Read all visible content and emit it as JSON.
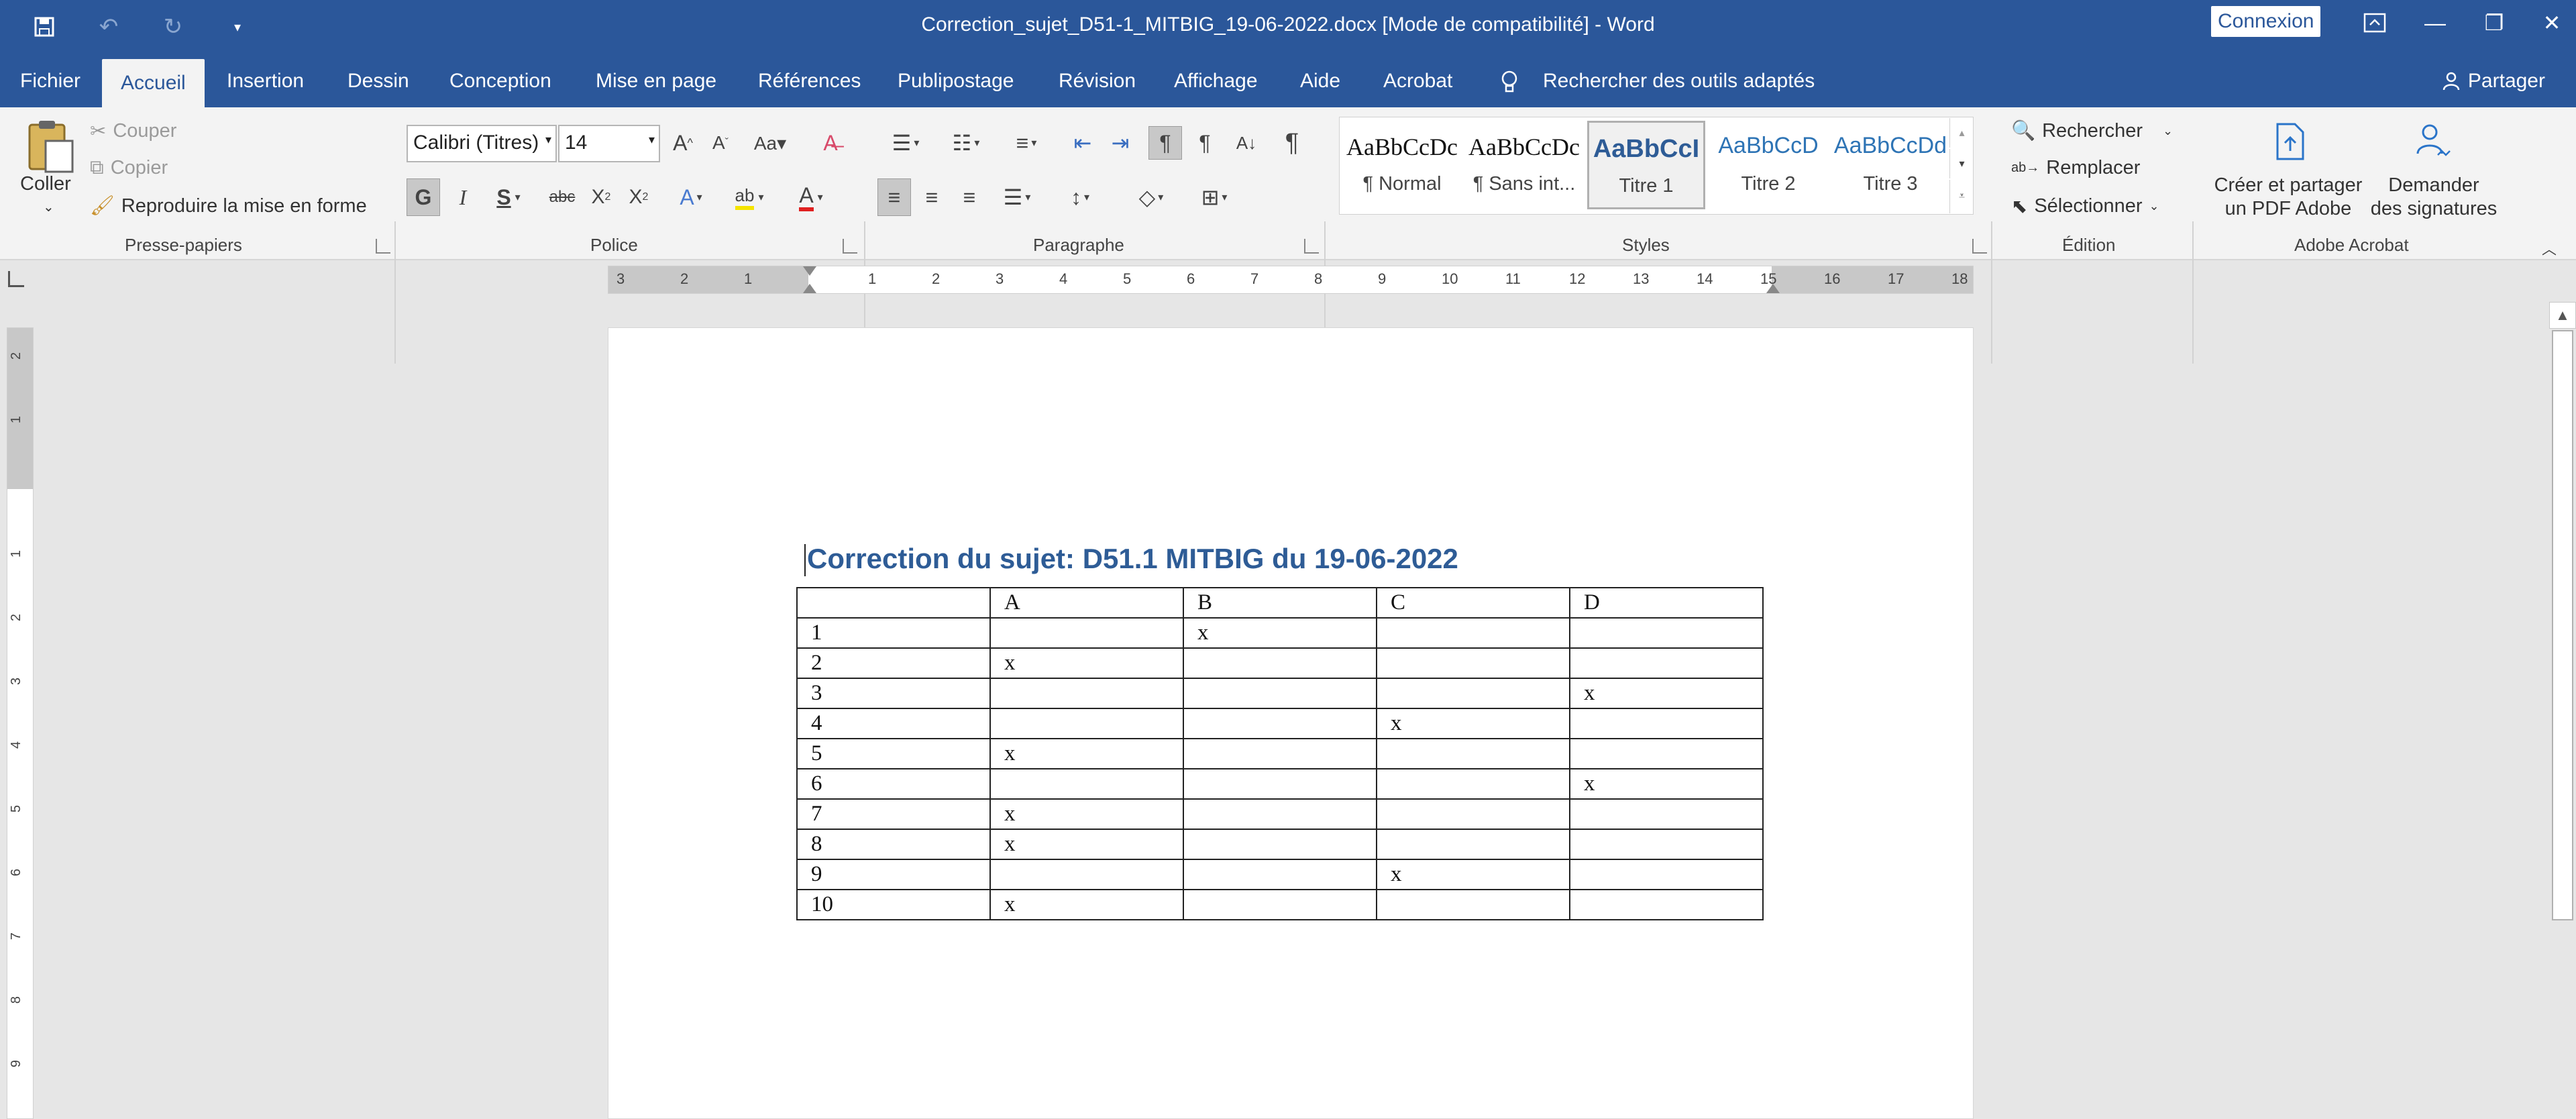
{
  "titlebar": {
    "document_title": "Correction_sujet_D51-1_MITBIG_19-06-2022.docx [Mode de compatibilité]  -  Word",
    "signin_label": "Connexion"
  },
  "tabs": [
    "Fichier",
    "Accueil",
    "Insertion",
    "Dessin",
    "Conception",
    "Mise en page",
    "Références",
    "Publipostage",
    "Révision",
    "Affichage",
    "Aide",
    "Acrobat"
  ],
  "tell_me": "Rechercher des outils adaptés",
  "share_label": "Partager",
  "clipboard": {
    "paste": "Coller",
    "cut": "Couper",
    "copy": "Copier",
    "format_painter": "Reproduire la mise en forme",
    "group": "Presse-papiers"
  },
  "font": {
    "name": "Calibri (Titres)",
    "size": "14",
    "group": "Police"
  },
  "paragraph": {
    "group": "Paragraphe"
  },
  "styles": {
    "group": "Styles",
    "items": [
      {
        "preview": "AaBbCcDc",
        "name": "¶ Normal",
        "color": "#111111"
      },
      {
        "preview": "AaBbCcDc",
        "name": "¶ Sans int...",
        "color": "#111111"
      },
      {
        "preview": "AaBbCcI",
        "name": "Titre 1",
        "color": "#2e5c96"
      },
      {
        "preview": "AaBbCcD",
        "name": "Titre 2",
        "color": "#2e74b5"
      },
      {
        "preview": "AaBbCcDd",
        "name": "Titre 3",
        "color": "#2e74b5"
      }
    ]
  },
  "editing": {
    "find": "Rechercher",
    "replace": "Remplacer",
    "select": "Sélectionner",
    "group": "Édition"
  },
  "acrobat": {
    "create_share_line1": "Créer et partager",
    "create_share_line2": "un PDF Adobe",
    "request_sig_line1": "Demander",
    "request_sig_line2": "des signatures",
    "group": "Adobe Acrobat"
  },
  "hruler_numbers": [
    "3",
    "2",
    "1",
    "1",
    "2",
    "3",
    "4",
    "5",
    "6",
    "7",
    "8",
    "9",
    "10",
    "11",
    "12",
    "13",
    "14",
    "15",
    "16",
    "17",
    "18"
  ],
  "vruler_numbers": [
    "2",
    "1",
    "1",
    "2",
    "3",
    "4",
    "5",
    "6",
    "7",
    "8",
    "9"
  ],
  "document": {
    "heading": "Correction du sujet: D51.1 MITBIG du 19-06-2022",
    "table": {
      "headers": [
        "",
        "A",
        "B",
        "C",
        "D"
      ],
      "rows": [
        [
          "1",
          "",
          "x",
          "",
          ""
        ],
        [
          "2",
          "x",
          "",
          "",
          ""
        ],
        [
          "3",
          "",
          "",
          "",
          "x"
        ],
        [
          "4",
          "",
          "",
          "x",
          ""
        ],
        [
          "5",
          "x",
          "",
          "",
          ""
        ],
        [
          "6",
          "",
          "",
          "",
          "x"
        ],
        [
          "7",
          "x",
          "",
          "",
          ""
        ],
        [
          "8",
          "x",
          "",
          "",
          ""
        ],
        [
          "9",
          "",
          "",
          "x",
          ""
        ],
        [
          "10",
          "x",
          "",
          "",
          ""
        ]
      ]
    }
  },
  "colors": {
    "brand": "#2b579a",
    "heading": "#2e5c96"
  }
}
